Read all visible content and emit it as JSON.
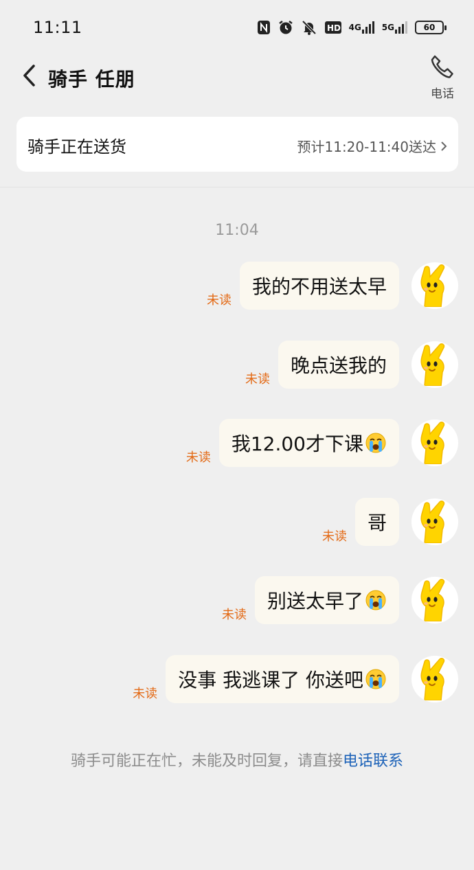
{
  "status_bar": {
    "time": "11:11",
    "net_4g": "4G",
    "net_5g": "5G",
    "battery": "60"
  },
  "header": {
    "title": "骑手 任朋",
    "call_label": "电话"
  },
  "delivery": {
    "status": "骑手正在送货",
    "eta": "预计11:20-11:40送达"
  },
  "chat": {
    "timestamp": "11:04",
    "unread_label": "未读",
    "messages": [
      {
        "text": "我的不用送太早",
        "emoji": false
      },
      {
        "text": "晚点送我的",
        "emoji": false
      },
      {
        "text": "我12.00才下课",
        "emoji": true
      },
      {
        "text": "哥",
        "emoji": false
      },
      {
        "text": "别送太早了",
        "emoji": true
      },
      {
        "text": "没事 我逃课了 你送吧",
        "emoji": true
      }
    ]
  },
  "footer": {
    "note": "骑手可能正在忙，未能及时回复，请直接",
    "link": "电话联系"
  },
  "colors": {
    "unread": "#e36a16",
    "link": "#1c62b8",
    "bubble": "#fbf8ef",
    "avatar_yellow": "#ffd400"
  }
}
